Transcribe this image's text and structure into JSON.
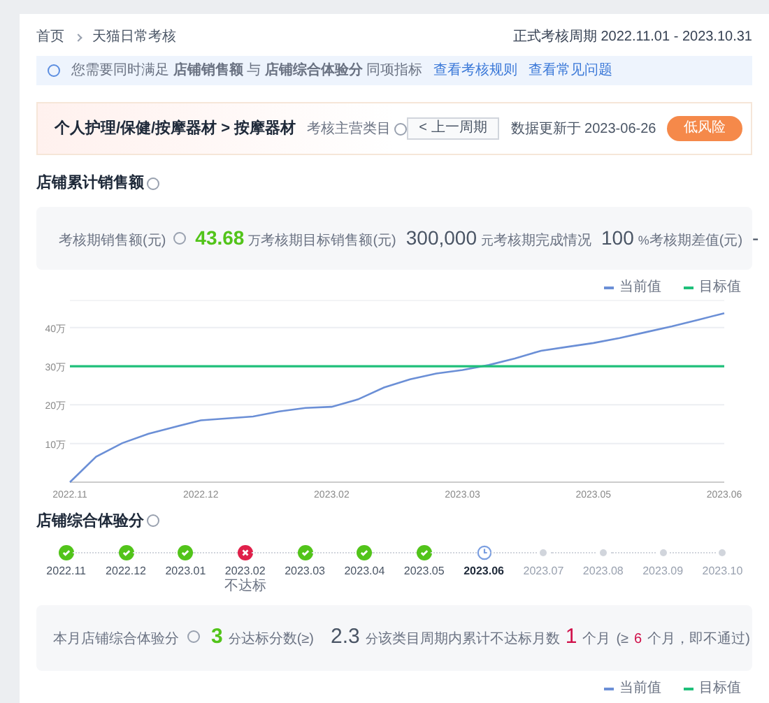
{
  "breadcrumb": [
    {
      "label": "首页"
    },
    {
      "label": "天猫日常考核"
    }
  ],
  "period": "正式考核周期 2022.11.01 - 2023.10.31",
  "notice": {
    "text": "您需要同时满足 **店铺销售额** 与 **店铺综合体验分** 同项指标",
    "links": [
      "查看考核规则",
      "查看常见问题"
    ]
  },
  "category": {
    "path": "个人护理/保健/按摩器材 > 按摩器材",
    "tag": "考核主营类目",
    "prev_button": "< 上一周期",
    "updated": "数据更新于 2023-06-26",
    "risk": "低风险"
  },
  "sales": {
    "title": "店铺累计销售额",
    "stats": [
      {
        "label": "考核期销售额(元)",
        "help": true,
        "value": "43.68",
        "unit": "万",
        "kind": "highlight"
      },
      {
        "label": "考核期目标销售额(元)",
        "help": false,
        "value": "300,000",
        "unit": "元",
        "kind": "plain"
      },
      {
        "label": "考核期完成情况",
        "help": false,
        "value": "100",
        "unit": "%",
        "kind": "plain"
      },
      {
        "label": "考核期差值(元)",
        "help": false,
        "value": "-",
        "kind": "plain"
      }
    ],
    "chart_data": {
      "type": "line",
      "categories": [
        "2022.11",
        null,
        null,
        null,
        null,
        "2022.12",
        null,
        null,
        null,
        null,
        "2023.02",
        null,
        null,
        null,
        null,
        "2023.03",
        null,
        null,
        null,
        null,
        "2023.05",
        null,
        null,
        null,
        null,
        "2023.06"
      ],
      "series": [
        {
          "name": "当前值",
          "color": "#6b8fd6",
          "values": [
            0,
            6.6,
            10.1,
            12.5,
            14.3,
            16,
            16.5,
            17,
            18.3,
            19.2,
            19.5,
            21.4,
            24.5,
            26.6,
            28.1,
            29,
            30.3,
            32,
            34,
            35,
            36,
            37.3,
            38.8,
            40.3,
            42,
            43.7
          ]
        },
        {
          "name": "目标值",
          "color": "#1fbf7a",
          "values": [
            30,
            30,
            30,
            30,
            30,
            30,
            30,
            30,
            30,
            30,
            30,
            30,
            30,
            30,
            30,
            30,
            30,
            30,
            30,
            30,
            30,
            30,
            30,
            30,
            30,
            30
          ]
        }
      ],
      "grid": true,
      "ylim": [
        0,
        47
      ],
      "yticks": [
        {
          "value": 10,
          "label": "10万"
        },
        {
          "value": 20,
          "label": "20万"
        },
        {
          "value": 30,
          "label": "30万"
        },
        {
          "value": 40,
          "label": "40万"
        }
      ]
    }
  },
  "score": {
    "title": "店铺综合体验分",
    "months": [
      {
        "label": "2022.11",
        "kind": "pass"
      },
      {
        "label": "2022.12",
        "kind": "pass"
      },
      {
        "label": "2023.01",
        "kind": "pass"
      },
      {
        "label": "2023.02",
        "kind": "fail",
        "note": "不达标"
      },
      {
        "label": "2023.03",
        "kind": "pass"
      },
      {
        "label": "2023.04",
        "kind": "pass"
      },
      {
        "label": "2023.05",
        "kind": "pass"
      },
      {
        "label": "2023.06",
        "kind": "current"
      },
      {
        "label": "2023.07",
        "kind": "future"
      },
      {
        "label": "2023.08",
        "kind": "future"
      },
      {
        "label": "2023.09",
        "kind": "future"
      },
      {
        "label": "2023.10",
        "kind": "future"
      }
    ],
    "current": {
      "label": "本月店铺综合体验分",
      "value": "3",
      "unit": "分"
    },
    "target": {
      "label": "达标分数(≥)",
      "value": "2.3",
      "unit": "分"
    },
    "fails": {
      "label": "该类目周期内累计不达标月数",
      "value": "1",
      "unit": "个月",
      "note_prefix": "(≥",
      "note_value": "6",
      "note_suffix": "个月，即不通过)"
    }
  },
  "bottom_legend": [
    {
      "name": "当前值",
      "color": "#6b8fd6"
    },
    {
      "name": "目标值",
      "color": "#1fbf7a"
    }
  ]
}
